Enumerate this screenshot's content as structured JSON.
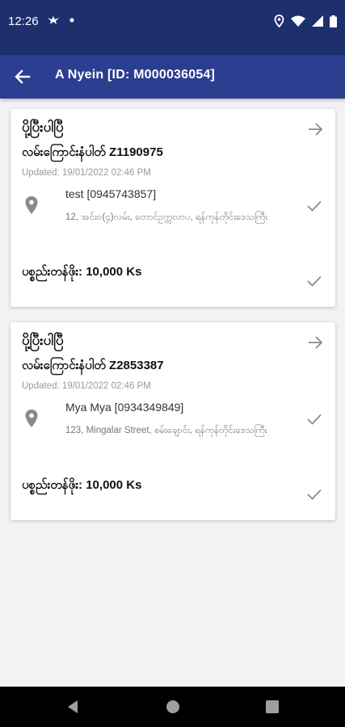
{
  "status_bar": {
    "time": "12:26",
    "left_icons": [
      "bird-icon",
      "dot-icon"
    ],
    "right_icons": [
      "location-icon",
      "wifi-icon",
      "signal-icon",
      "battery-icon"
    ]
  },
  "app_bar": {
    "title": "A Nyein [ID: M000036054]"
  },
  "cards": [
    {
      "status": "ပို့ပြီးပါပြီ",
      "tracking": "လမ်းကြောင်းနံပါတ် Z1190975",
      "updated": "Updated: 19/01/2022 02:46 PM",
      "recipient": "test [0945743857]",
      "address": "12, အင်းဝ(၄)လမ်း, တောင်ဥက္ကလာပ, ရန်ကုန်တိုင်းဒေသကြီး",
      "price": "ပစ္စည်းတန်ဖိုး: 10,000 Ks"
    },
    {
      "status": "ပို့ပြီးပါပြီ",
      "tracking": "လမ်းကြောင်းနံပါတ် Z2853387",
      "updated": "Updated: 19/01/2022 02:46 PM",
      "recipient": "Mya Mya [0934349849]",
      "address": "123, Mingalar Street, စမ်းချောင်း, ရန်ကုန်တိုင်းဒေသကြီး",
      "price": "ပစ္စည်းတန်ဖိုး: 10,000 Ks"
    }
  ],
  "colors": {
    "status_bar": "#1e2f6e",
    "app_bar": "#2c3e8f",
    "background": "#f2f2f4",
    "icon_gray": "#8a8a8a"
  }
}
